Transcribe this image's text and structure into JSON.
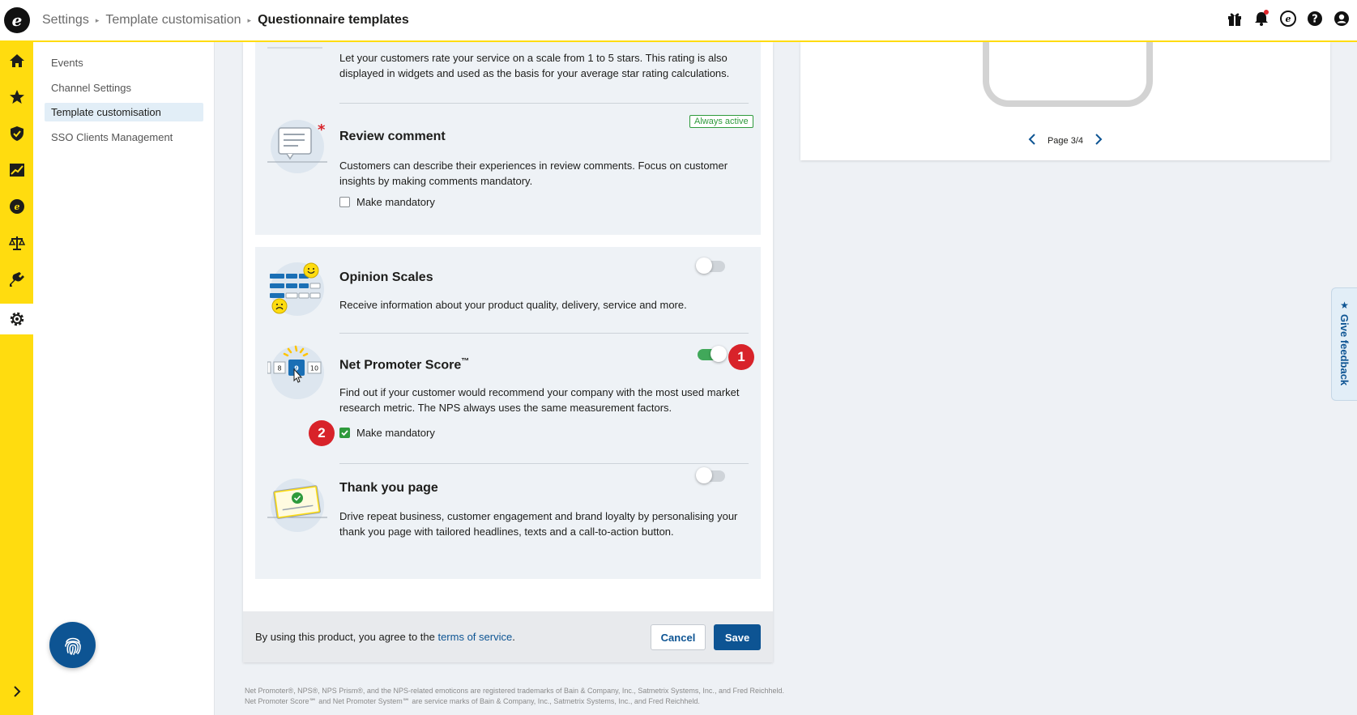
{
  "header": {
    "breadcrumbs": [
      "Settings",
      "Template customisation"
    ],
    "current": "Questionnaire templates"
  },
  "sidebar": {
    "items": [
      {
        "label": "Events"
      },
      {
        "label": "Channel Settings"
      },
      {
        "label": "Template customisation"
      },
      {
        "label": "SSO Clients Management"
      }
    ]
  },
  "features": {
    "star_rating": {
      "description": "Let your customers rate your service on a scale from 1 to 5 stars. This rating is also displayed in widgets and used as the basis for your average star rating calculations."
    },
    "review_comment": {
      "badge": "Always active",
      "title": "Review comment",
      "description": "Customers can describe their experiences in review comments. Focus on customer insights by making comments mandatory.",
      "mandatory_label": "Make mandatory",
      "mandatory": false
    },
    "opinion_scales": {
      "title": "Opinion Scales",
      "description": "Receive information about your product quality, delivery, service and more.",
      "enabled": false
    },
    "nps": {
      "title": "Net Promoter Score",
      "sup": "™",
      "description": "Find out if your customer would recommend your company with the most used market research metric. The NPS always uses the same measurement factors.",
      "mandatory_label": "Make mandatory",
      "mandatory": true,
      "enabled": true,
      "illus_numbers": [
        "8",
        "9",
        "10"
      ]
    },
    "thank_you": {
      "title": "Thank you page",
      "description": "Drive repeat business, customer engagement and brand loyalty by personalising your thank you page with tailored headlines, texts and a call-to-action button.",
      "enabled": false
    }
  },
  "steps": [
    "1",
    "2"
  ],
  "footer": {
    "terms_prefix": "By using this product, you agree to the ",
    "terms_link": "terms of service",
    "terms_suffix": ".",
    "cancel": "Cancel",
    "save": "Save"
  },
  "legal": "Net Promoter®, NPS®, NPS Prism®, and the NPS-related emoticons are registered trademarks of Bain & Company, Inc., Satmetrix Systems, Inc., and Fred Reichheld. Net Promoter Score℠ and Net Promoter System℠ are service marks of Bain & Company, Inc., Satmetrix Systems, Inc., and Fred Reichheld.",
  "preview": {
    "page_label": "Page 3/4"
  },
  "feedback_tab": {
    "label": "Give feedback"
  },
  "colors": {
    "brand_yellow": "#ffdc0f",
    "primary_blue": "#0d5493",
    "success_green": "#2e9a3c",
    "step_red": "#d8232a"
  }
}
